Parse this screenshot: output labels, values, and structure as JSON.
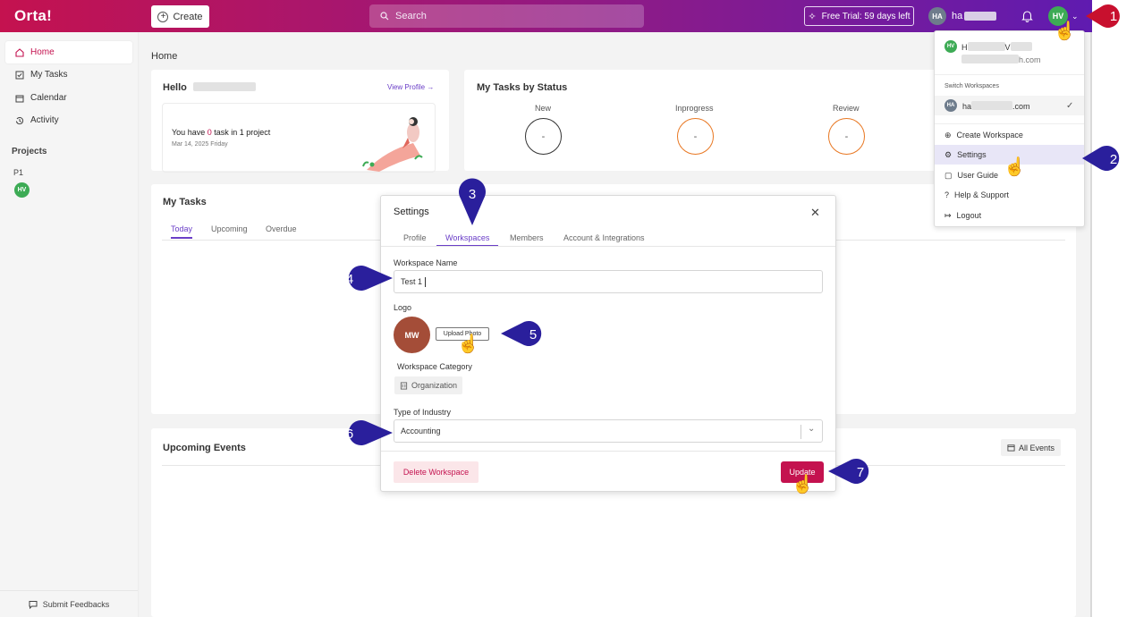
{
  "topbar": {
    "logo": "Orta!",
    "create_label": "Create",
    "search_placeholder": "Search",
    "trial_label": "Free Trial: 59 days left",
    "user_initials": "HA",
    "user_name": "ha",
    "avatar_initials": "HV"
  },
  "sidebar": {
    "items": [
      {
        "label": "Home",
        "icon": "home-icon"
      },
      {
        "label": "My Tasks",
        "icon": "checkbox-icon"
      },
      {
        "label": "Calendar",
        "icon": "calendar-icon"
      },
      {
        "label": "Activity",
        "icon": "history-icon"
      }
    ],
    "projects_heading": "Projects",
    "project_name": "P1",
    "project_avatar": "HV",
    "feedback_label": "Submit Feedbacks"
  },
  "main": {
    "breadcrumb": "Home",
    "hello": {
      "greeting": "Hello",
      "view_profile": "View Profile →",
      "summary_prefix": "You have ",
      "task_count": "0",
      "summary_mid": " task in ",
      "project_count": "1",
      "summary_suffix": " project",
      "date": "Mar 14, 2025 Friday"
    },
    "status": {
      "title": "My Tasks by Status",
      "items": [
        {
          "label": "New",
          "value": "-",
          "color": "#333333"
        },
        {
          "label": "Inprogress",
          "value": "-",
          "color": "#e87722"
        },
        {
          "label": "Review",
          "value": "-",
          "color": "#e87722"
        }
      ]
    },
    "my_tasks": {
      "title": "My Tasks",
      "tabs": [
        "Today",
        "Upcoming",
        "Overdue"
      ]
    },
    "events": {
      "title": "Upcoming Events",
      "all_events": "All Events"
    }
  },
  "modal": {
    "title": "Settings",
    "tabs": [
      "Profile",
      "Workspaces",
      "Members",
      "Account & Integrations"
    ],
    "workspace_name_label": "Workspace Name",
    "workspace_name_value": "Test 1",
    "logo_label": "Logo",
    "logo_initials": "MW",
    "upload_label": "Upload Photo",
    "category_label": "Workspace Category",
    "category_value": "Organization",
    "industry_label": "Type of Industry",
    "industry_value": "Accounting",
    "delete_label": "Delete Workspace",
    "update_label": "Update"
  },
  "dropdown": {
    "user_initials": "HV",
    "user_name_start": "H",
    "user_name_mid": "V",
    "user_email_end": "h.com",
    "switch_heading": "Switch Workspaces",
    "workspace_initials": "HA",
    "workspace_start": "ha",
    "workspace_end": ".com",
    "items": [
      "Create Workspace",
      "Settings",
      "User Guide",
      "Help & Support",
      "Logout"
    ]
  },
  "callouts": [
    "1",
    "2",
    "3",
    "4",
    "5",
    "6",
    "7"
  ],
  "colors": {
    "brand": "#c4124f",
    "accent": "#6a3ec7",
    "callout_blue": "#2a1f9c",
    "callout_red": "#c8102e"
  }
}
